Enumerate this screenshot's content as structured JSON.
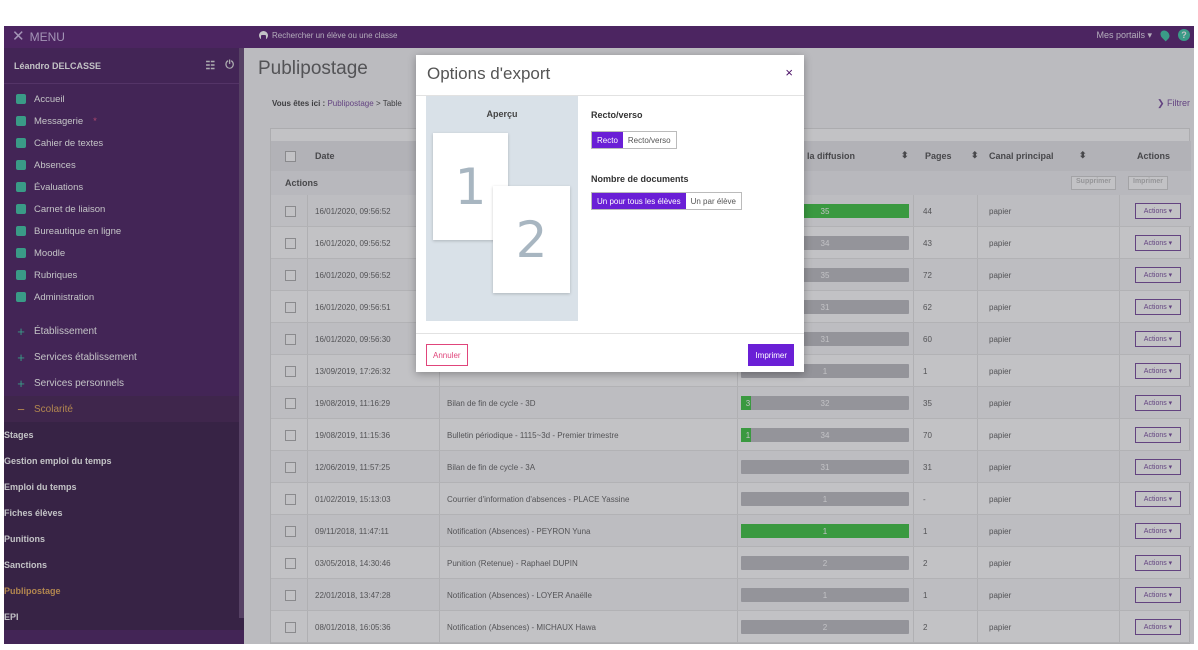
{
  "topbar": {
    "menu_label": "MENU",
    "search_placeholder": "Rechercher un élève ou une classe",
    "portals_label": "Mes portails"
  },
  "sidebar": {
    "user_name": "Léandro DELCASSE",
    "items": [
      {
        "label": "Accueil",
        "icon": "home-icon",
        "color": "#2ec4a0"
      },
      {
        "label": "Messagerie",
        "icon": "mail-icon",
        "color": "#2ec4a0",
        "badge": "*"
      },
      {
        "label": "Cahier de textes",
        "icon": "book-icon",
        "color": "#2ec4a0"
      },
      {
        "label": "Absences",
        "icon": "person-icon",
        "color": "#2ec4a0"
      },
      {
        "label": "Évaluations",
        "icon": "chart-icon",
        "color": "#2ec4a0"
      },
      {
        "label": "Carnet de liaison",
        "icon": "infinity-icon",
        "color": "#2ec4a0"
      },
      {
        "label": "Bureautique en ligne",
        "icon": "document-icon",
        "color": "#2ec4a0"
      },
      {
        "label": "Moodle",
        "icon": "moodle-icon",
        "color": "#2ec4a0"
      },
      {
        "label": "Rubriques",
        "icon": "folder-icon",
        "color": "#2ec4a0"
      },
      {
        "label": "Administration",
        "icon": "gear-icon",
        "color": "#2ec4a0"
      }
    ],
    "sections": [
      {
        "label": "Établissement",
        "sign": "+"
      },
      {
        "label": "Services établissement",
        "sign": "+"
      },
      {
        "label": "Services personnels",
        "sign": "+"
      },
      {
        "label": "Scolarité",
        "sign": "−"
      }
    ],
    "sub_items": [
      "Stages",
      "Gestion emploi du temps",
      "Emploi du temps",
      "Fiches élèves",
      "Punitions",
      "Sanctions",
      "Publipostage",
      "EPI"
    ],
    "active_sub": "Publipostage"
  },
  "main": {
    "title": "Publipostage",
    "breadcrumb_prefix": "Vous êtes ici :",
    "breadcrumb_link": "Publipostage",
    "breadcrumb_sep": ">",
    "breadcrumb_next": "Table",
    "filter_label": "Filtrer"
  },
  "table": {
    "headers": {
      "date": "Date",
      "diffusion": "la diffusion",
      "pages": "Pages",
      "canal": "Canal principal",
      "actions": "Actions"
    },
    "actions_row_label": "Actions",
    "delete_label": "Supprimer",
    "print_label": "Imprimer",
    "row_action_label": "Actions ▾",
    "rows": [
      {
        "date": "16/01/2020, 09:56:52",
        "doc": "",
        "diff": "35",
        "fill": 1.0,
        "pages": "44",
        "canal": "papier"
      },
      {
        "date": "16/01/2020, 09:56:52",
        "doc": "",
        "diff": "34",
        "fill": 0,
        "pages": "43",
        "canal": "papier"
      },
      {
        "date": "16/01/2020, 09:56:52",
        "doc": "",
        "diff": "35",
        "fill": 0,
        "pages": "72",
        "canal": "papier"
      },
      {
        "date": "16/01/2020, 09:56:51",
        "doc": "",
        "diff": "31",
        "fill": 0,
        "pages": "62",
        "canal": "papier"
      },
      {
        "date": "16/01/2020, 09:56:30",
        "doc": "",
        "diff": "31",
        "fill": 0,
        "pages": "60",
        "canal": "papier"
      },
      {
        "date": "13/09/2019, 17:26:32",
        "doc": "",
        "diff": "1",
        "fill": 0,
        "pages": "1",
        "canal": "papier"
      },
      {
        "date": "19/08/2019, 11:16:29",
        "doc": "Bilan de fin de cycle - 3D",
        "diff": "32",
        "fill": 0.06,
        "fillval": "3",
        "pages": "35",
        "canal": "papier"
      },
      {
        "date": "19/08/2019, 11:15:36",
        "doc": "Bulletin périodique - 1115~3d - Premier trimestre",
        "diff": "34",
        "fill": 0.06,
        "fillval": "1",
        "pages": "70",
        "canal": "papier"
      },
      {
        "date": "12/06/2019, 11:57:25",
        "doc": "Bilan de fin de cycle - 3A",
        "diff": "31",
        "fill": 0,
        "pages": "31",
        "canal": "papier"
      },
      {
        "date": "01/02/2019, 15:13:03",
        "doc": "Courrier d'information d'absences - PLACE Yassine",
        "diff": "1",
        "fill": 0,
        "pages": "-",
        "canal": "papier"
      },
      {
        "date": "09/11/2018, 11:47:11",
        "doc": "Notification (Absences) - PEYRON Yuna",
        "diff": "1",
        "fill": 1.0,
        "pages": "1",
        "canal": "papier"
      },
      {
        "date": "03/05/2018, 14:30:46",
        "doc": "Punition (Retenue) - Raphael DUPIN",
        "diff": "2",
        "fill": 0,
        "pages": "2",
        "canal": "papier"
      },
      {
        "date": "22/01/2018, 13:47:28",
        "doc": "Notification (Absences) - LOYER Anaëlle",
        "diff": "1",
        "fill": 0,
        "pages": "1",
        "canal": "papier"
      },
      {
        "date": "08/01/2018, 16:05:36",
        "doc": "Notification (Absences) - MICHAUX Hawa",
        "diff": "2",
        "fill": 0,
        "pages": "2",
        "canal": "papier"
      }
    ]
  },
  "modal": {
    "title": "Options d'export",
    "close": "×",
    "preview_label": "Aperçu",
    "page1": "1",
    "page2": "2",
    "recto_label": "Recto/verso",
    "recto_options": [
      "Recto",
      "Recto/verso"
    ],
    "recto_selected": "Recto",
    "docs_label": "Nombre de documents",
    "docs_options": [
      "Un pour tous les élèves",
      "Un par élève"
    ],
    "docs_selected": "Un pour tous les élèves",
    "cancel_label": "Annuler",
    "print_label": "Imprimer"
  },
  "colors": {
    "primary": "#6a1fd6",
    "topbar": "#4a0f66",
    "sidebar": "#3d0e55",
    "success": "#2fc034",
    "danger": "#e0457b",
    "accent": "#2ec4a0"
  }
}
